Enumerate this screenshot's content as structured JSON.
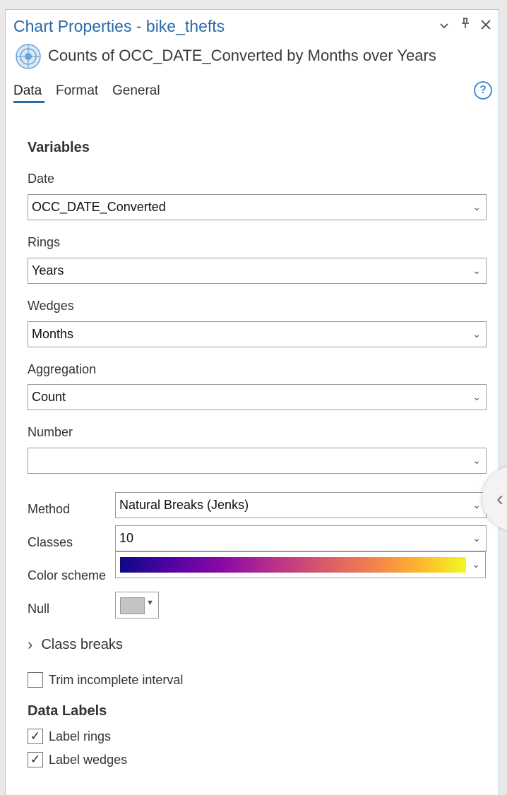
{
  "window": {
    "title": "Chart Properties - bike_thefts",
    "controls": {
      "dropdown": "⌄",
      "pin": "‡",
      "close": "✕"
    }
  },
  "chart": {
    "icon": "radial-chart-icon",
    "subtitle": "Counts of OCC_DATE_Converted by Months over Years"
  },
  "tabs": [
    {
      "label": "Data",
      "active": true
    },
    {
      "label": "Format",
      "active": false
    },
    {
      "label": "General",
      "active": false
    }
  ],
  "help": {
    "glyph": "?"
  },
  "variables": {
    "heading": "Variables",
    "date": {
      "label": "Date",
      "value": "OCC_DATE_Converted"
    },
    "rings": {
      "label": "Rings",
      "value": "Years"
    },
    "wedges": {
      "label": "Wedges",
      "value": "Months"
    },
    "aggregation": {
      "label": "Aggregation",
      "value": "Count"
    },
    "number": {
      "label": "Number",
      "value": ""
    }
  },
  "symbology": {
    "method": {
      "label": "Method",
      "value": "Natural Breaks (Jenks)"
    },
    "classes": {
      "label": "Classes",
      "value": "10"
    },
    "color_scheme": {
      "label": "Color scheme",
      "colors": [
        "#0d0887",
        "#8b0aa5",
        "#db5c68",
        "#febc2a",
        "#f0f921"
      ]
    },
    "null": {
      "label": "Null",
      "color": "#c4c4c4"
    }
  },
  "class_breaks": {
    "chevron": "›",
    "label": "Class breaks"
  },
  "trim": {
    "label": "Trim incomplete interval",
    "checked": false
  },
  "data_labels": {
    "heading": "Data Labels",
    "label_rings": {
      "label": "Label rings",
      "checked": true,
      "mark": "✓"
    },
    "label_wedges": {
      "label": "Label wedges",
      "checked": true,
      "mark": "✓"
    }
  },
  "chevron": "⌄",
  "colors": {
    "accent": "#2a6aa7",
    "help": "#4a8fd1"
  }
}
